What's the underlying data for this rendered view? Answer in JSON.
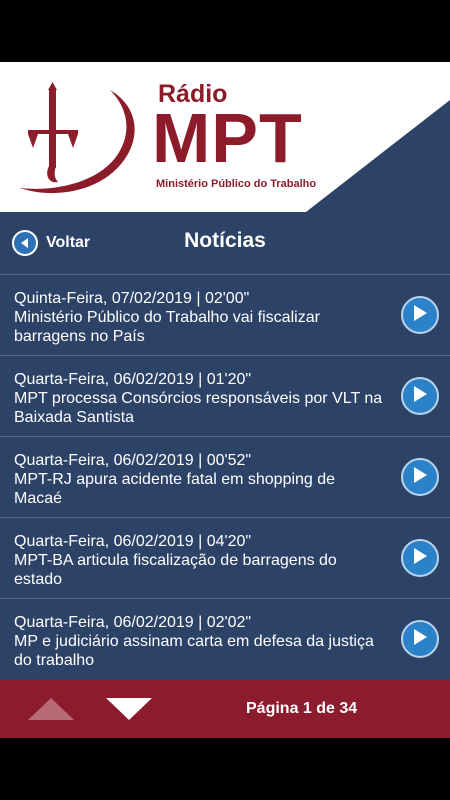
{
  "brand": {
    "radio": "Rádio",
    "mpt": "MPT",
    "subtitle": "Ministério Público do Trabalho"
  },
  "nav": {
    "back_label": "Voltar",
    "title": "Notícias"
  },
  "news": [
    {
      "date": "Quinta-Feira, 07/02/2019 | 02'00\"",
      "title": "Ministério Público do Trabalho vai fiscalizar barragens no País"
    },
    {
      "date": "Quarta-Feira, 06/02/2019 | 01'20\"",
      "title": "MPT processa Consórcios responsáveis por VLT na Baixada Santista"
    },
    {
      "date": "Quarta-Feira, 06/02/2019 | 00'52\"",
      "title": "MPT-RJ apura acidente fatal em shopping de Macaé"
    },
    {
      "date": "Quarta-Feira, 06/02/2019 | 04'20\"",
      "title": "MPT-BA articula fiscalização de barragens do estado"
    },
    {
      "date": "Quarta-Feira, 06/02/2019 | 02'02\"",
      "title": "MP e judiciário assinam carta em defesa da justiça do trabalho"
    }
  ],
  "footer": {
    "page_info": "Página 1 de 34"
  },
  "icons": {
    "back": "back-arrow-icon",
    "play": "play-icon",
    "prev": "page-up-icon",
    "next": "page-down-icon"
  },
  "colors": {
    "navy": "#2c4266",
    "maroon": "#8b1b2d",
    "accent_blue": "#2c82c9"
  }
}
